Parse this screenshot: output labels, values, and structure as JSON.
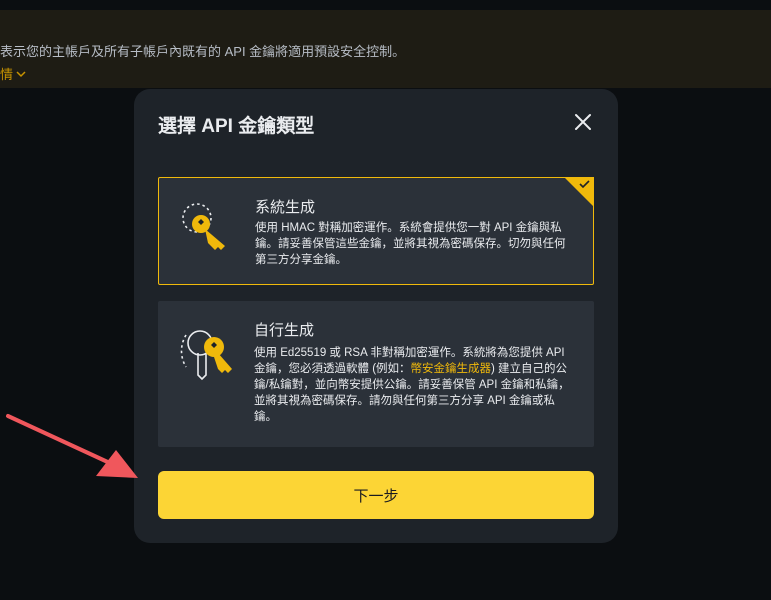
{
  "banner": {
    "text": "表示您的主帳戶及所有子帳戶內既有的 API 金鑰將適用預設安全控制。",
    "link_label": "情"
  },
  "modal": {
    "title": "選擇 API 金鑰類型",
    "options": [
      {
        "title": "系統生成",
        "description": "使用 HMAC 對稱加密運作。系統會提供您一對 API 金鑰與私鑰。請妥善保管這些金鑰，並將其視為密碼保存。切勿與任何第三方分享金鑰。",
        "selected": true,
        "icon": "system-key-icon"
      },
      {
        "title": "自行生成",
        "desc_before": "使用 Ed25519 或 RSA 非對稱加密運作。系統將為您提供 API 金鑰，您必須透過軟體 (例如：",
        "desc_link": "幣安金鑰生成器",
        "desc_after": ") 建立自己的公鑰/私鑰對，並向幣安提供公鑰。請妥善保管 API 金鑰和私鑰，並將其視為密碼保存。請勿與任何第三方分享 API 金鑰或私鑰。",
        "selected": false,
        "icon": "self-generated-keys-icon"
      }
    ],
    "next_label": "下一步"
  },
  "colors": {
    "accent": "#fcd535",
    "link": "#f0b90b",
    "annotation_arrow": "#f0575c"
  }
}
